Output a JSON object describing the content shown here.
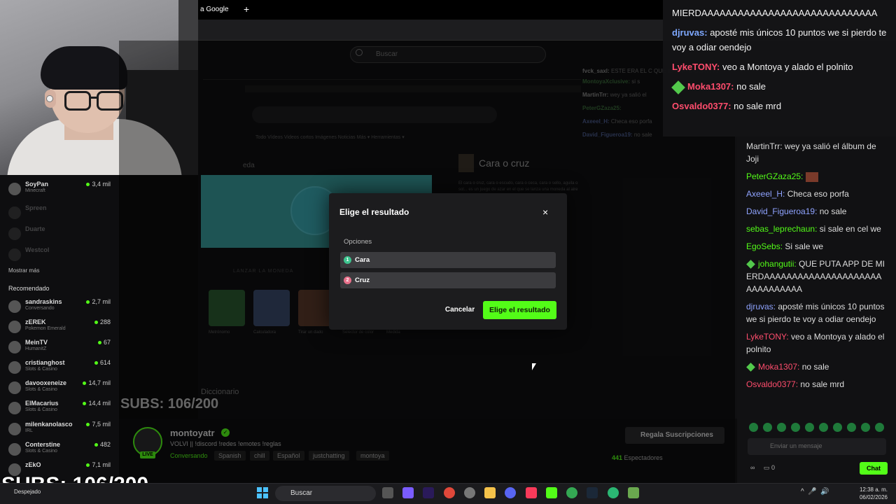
{
  "browser": {
    "tab_title": "a Google",
    "new_tab": "+"
  },
  "stream_page": {
    "search_placeholder": "Buscar",
    "inner": {
      "nav": "Todo    Vídeos    Videos cortos    Imágenes    Noticias    Más ▾    Herramientas ▾",
      "card_heading": "eda",
      "lanzar": "LANZAR LA MONEDA",
      "panel_title": "Cara o cruz",
      "panel_body": "El cara o cruz, cara o escudo, cara o ceca, cara o sello, aguila o sol... es un juego de azar en el que se lanza una moneda al aire y se predice el lado que caerá.",
      "tools": [
        "Metrónomo",
        "Calculadora",
        "Tirar un dado",
        "Selector de color",
        "Medida"
      ],
      "diccionario": "Diccionario",
      "subs": "SUBS: 106/200"
    },
    "stream_chat": [
      {
        "user": "fvck_saxl:",
        "text": "ESTE ERA EL C QUE IBAS A HACER????"
      },
      {
        "user": "MontoyaXclusive:",
        "text": "si s"
      },
      {
        "user": "MartinTrr:",
        "text": "wey ya salió el"
      },
      {
        "user": "PeterGZaza25:",
        "text": ""
      },
      {
        "user": "Axeeel_H:",
        "text": "Checa eso porfa"
      },
      {
        "user": "David_Figueroa19:",
        "text": "no sale"
      }
    ]
  },
  "sidebar": {
    "channels_top": [
      {
        "name": "SoyPan",
        "game": "Minecraft",
        "viewers": "3,4 mil",
        "faded": false
      },
      {
        "name": "Spreen",
        "game": "",
        "viewers": "",
        "faded": true
      },
      {
        "name": "Duarte",
        "game": "",
        "viewers": "",
        "faded": true
      },
      {
        "name": "Westcol",
        "game": "",
        "viewers": "",
        "faded": true
      }
    ],
    "show_more": "Mostrar más",
    "recommended_label": "Recomendado",
    "recommended": [
      {
        "name": "sandraskins",
        "game": "Conversando",
        "viewers": "2,7 mil"
      },
      {
        "name": "zEREK",
        "game": "Pokemon Emerald",
        "viewers": "288"
      },
      {
        "name": "MeinTV",
        "game": "HumanitZ",
        "viewers": "67"
      },
      {
        "name": "cristianghost",
        "game": "Slots & Casino",
        "viewers": "614"
      },
      {
        "name": "davooxeneize",
        "game": "Slots & Casino",
        "viewers": "14,7 mil"
      },
      {
        "name": "ElMacarius",
        "game": "Slots & Casino",
        "viewers": "14,4 mil"
      },
      {
        "name": "milenkanolasco",
        "game": "IRL",
        "viewers": "7,5 mil"
      },
      {
        "name": "Conterstine",
        "game": "Slots & Casino",
        "viewers": "482"
      },
      {
        "name": "zEkO",
        "game": "",
        "viewers": "7,1 mil"
      }
    ]
  },
  "subs_overlay": "SUBS: 106/200",
  "stream_info": {
    "channel": "montoyatr",
    "live": "LIVE",
    "title": "VOLVI || !discord !redes !emotes !reglas",
    "category": "Conversando",
    "tags": [
      "Spanish",
      "chill",
      "Español",
      "justchatting",
      "montoya"
    ],
    "gift_label": "Regala Suscripciones",
    "viewers_count": "441",
    "viewers_label": "Espectadores"
  },
  "overlay_chat": [
    {
      "user": "",
      "text": "MIERDAAAAAAAAAAAAAAAAAAAAAAAAAAAA"
    },
    {
      "user": "djruvas:",
      "text": "aposté mis únicos 10 puntos we si pierdo te voy a odiar oendejo",
      "color": "#7ea8ff"
    },
    {
      "user": "LykeTONY:",
      "text": "veo a Montoya y alado el polnito",
      "color": "#ff4d6d"
    },
    {
      "user": "Moka1307:",
      "text": "no sale",
      "color": "#ff4d6d"
    },
    {
      "user": "Osvaldo0377:",
      "text": "no sale mrd",
      "color": "#ff4d6d"
    }
  ],
  "chat": {
    "messages": [
      {
        "user": "MartinTrr:",
        "text": "wey ya salió el álbum de Joji",
        "color": "#dddddd"
      },
      {
        "user": "PeterGZaza25:",
        "text": "",
        "color": "#53fc18"
      },
      {
        "user": "Axeeel_H:",
        "text": "Checa eso porfa",
        "color": "#8fa3ff"
      },
      {
        "user": "David_Figueroa19:",
        "text": "no sale",
        "color": "#8fa3ff"
      },
      {
        "user": "sebas_leprechaun:",
        "text": "si sale en cel we",
        "color": "#53fc18"
      },
      {
        "user": "EgoSebs:",
        "text": "Si sale we",
        "color": "#53fc18"
      },
      {
        "user": "johangutii:",
        "text": "QUE PUTA APP DE MIERDAAAAAAAAAAAAAAAAAAAAAAAAAAAAAAA",
        "color": "#53fc18"
      },
      {
        "user": "djruvas:",
        "text": "aposté mis únicos 10 puntos we si pierdo te voy a odiar oendejo",
        "color": "#8fa3ff"
      },
      {
        "user": "LykeTONY:",
        "text": "veo a Montoya y alado el polnito",
        "color": "#ff4d6d"
      },
      {
        "user": "Moka1307:",
        "text": "no sale",
        "color": "#ff4d6d"
      },
      {
        "user": "Osvaldo0377:",
        "text": "no sale mrd",
        "color": "#ff4d6d"
      }
    ],
    "input_placeholder": "Enviar un mensaje",
    "send": "Chat",
    "points": "0"
  },
  "modal": {
    "title": "Elige el resultado",
    "close": "×",
    "options_label": "Opciones",
    "options": [
      {
        "num": "1",
        "label": "Cara",
        "color": "#3ec48f"
      },
      {
        "num": "2",
        "label": "Cruz",
        "color": "#e8708a"
      }
    ],
    "cancel": "Cancelar",
    "confirm": "Elige el resultado",
    "accent": "#53fc18"
  },
  "taskbar": {
    "weather": "Despejado",
    "search": "Buscar",
    "time": "12:38 a. m.",
    "date": "06/02/2026"
  }
}
